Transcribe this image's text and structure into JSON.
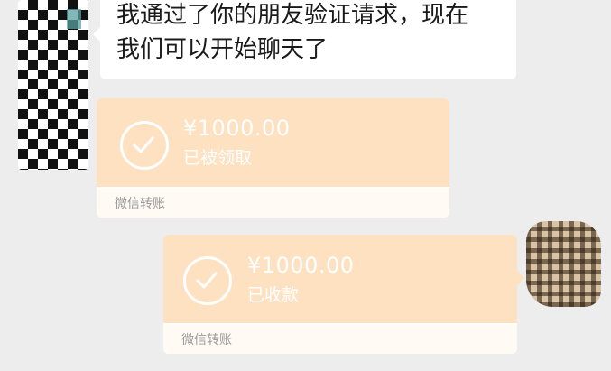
{
  "chat": {
    "message_text": "我通过了你的朋友验证请求，现在\n我们可以开始聊天了",
    "transfer_received": {
      "amount": "¥1000.00",
      "status": "已被领取",
      "footer": "微信转账"
    },
    "transfer_sent": {
      "amount": "¥1000.00",
      "status": "已收款",
      "footer": "微信转账"
    }
  },
  "colors": {
    "background": "#ededed",
    "transfer_orange": "#fde1c1",
    "text_bubble": "#ffffff"
  },
  "icons": {
    "transfer_status": "check-circle-icon"
  }
}
